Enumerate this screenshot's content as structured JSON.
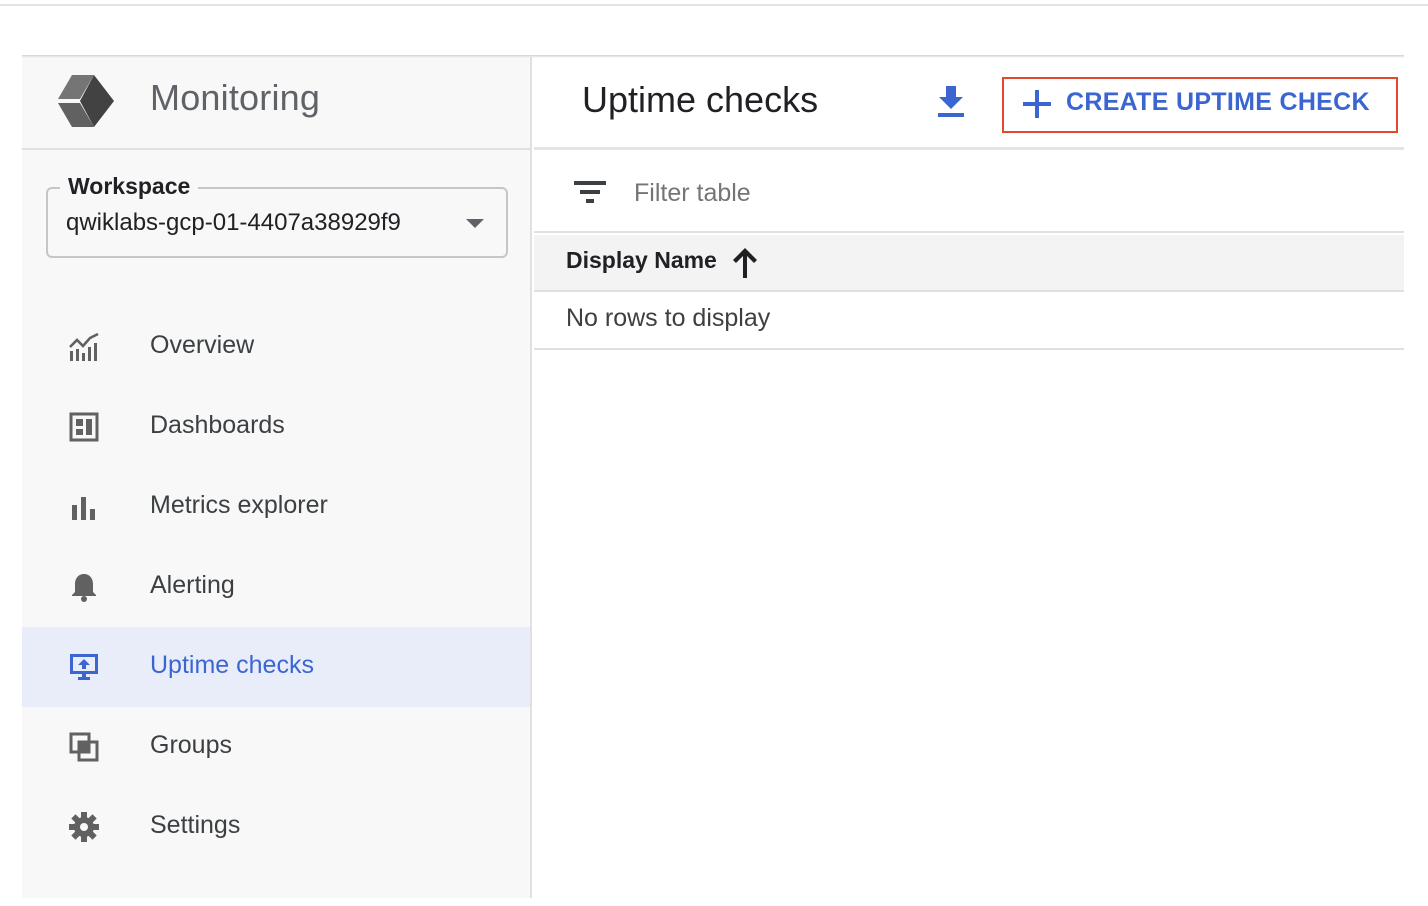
{
  "app": {
    "title": "Monitoring",
    "logo_icon": "stackdriver-logo-icon"
  },
  "workspace": {
    "label": "Workspace",
    "value": "qwiklabs-gcp-01-4407a38929f9"
  },
  "sidebar": {
    "items": [
      {
        "label": "Overview",
        "icon": "overview-chart-icon",
        "active": false
      },
      {
        "label": "Dashboards",
        "icon": "dashboard-icon",
        "active": false
      },
      {
        "label": "Metrics explorer",
        "icon": "bar-chart-icon",
        "active": false
      },
      {
        "label": "Alerting",
        "icon": "bell-icon",
        "active": false
      },
      {
        "label": "Uptime checks",
        "icon": "monitor-upload-icon",
        "active": true
      },
      {
        "label": "Groups",
        "icon": "groups-icon",
        "active": false
      },
      {
        "label": "Settings",
        "icon": "gear-icon",
        "active": false
      }
    ]
  },
  "header": {
    "title": "Uptime checks",
    "download_icon": "download-icon",
    "create_label": "CREATE UPTIME CHECK",
    "create_icon": "plus-icon"
  },
  "filter": {
    "placeholder": "Filter table",
    "icon": "filter-list-icon"
  },
  "table": {
    "columns": [
      {
        "label": "Display Name",
        "sort": "ascending",
        "sort_icon": "arrow-up-icon"
      }
    ],
    "empty_message": "No rows to display"
  },
  "colors": {
    "accent": "#3b66d1",
    "highlight_border": "#e0492f",
    "active_nav_bg": "#e9edf9",
    "sidebar_bg": "#f8f8f8"
  }
}
